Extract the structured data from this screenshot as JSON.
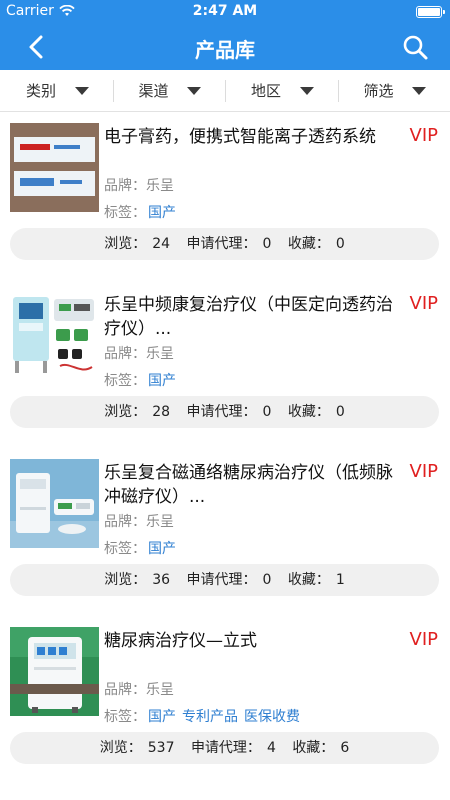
{
  "status_bar": {
    "carrier": "Carrier",
    "time": "2:47 AM",
    "battery_level": 1.0
  },
  "nav": {
    "title": "产品库",
    "back_icon": "chevron-left-icon",
    "search_icon": "search-icon"
  },
  "filters": [
    {
      "label": "类别"
    },
    {
      "label": "渠道"
    },
    {
      "label": "地区"
    },
    {
      "label": "筛选"
    }
  ],
  "products": [
    {
      "title": "电子膏药，便携式智能离子透药系统",
      "vip": "VIP",
      "brand_label": "品牌：",
      "brand": "乐呈",
      "tags_label": "标签：",
      "tags": [
        "国产"
      ],
      "views_label": "浏览：",
      "views": "24",
      "agents_label": "申请代理：",
      "agents": "0",
      "favorites_label": "收藏：",
      "favorites": "0"
    },
    {
      "title": "乐呈中频康复治疗仪（中医定向透药治疗仪）...",
      "vip": "VIP",
      "brand_label": "品牌：",
      "brand": "乐呈",
      "tags_label": "标签：",
      "tags": [
        "国产"
      ],
      "views_label": "浏览：",
      "views": "28",
      "agents_label": "申请代理：",
      "agents": "0",
      "favorites_label": "收藏：",
      "favorites": "0"
    },
    {
      "title": "乐呈复合磁通络糖尿病治疗仪（低频脉冲磁疗仪）...",
      "vip": "VIP",
      "brand_label": "品牌：",
      "brand": "乐呈",
      "tags_label": "标签：",
      "tags": [
        "国产"
      ],
      "views_label": "浏览：",
      "views": "36",
      "agents_label": "申请代理：",
      "agents": "0",
      "favorites_label": "收藏：",
      "favorites": "1"
    },
    {
      "title": "糖尿病治疗仪—立式",
      "vip": "VIP",
      "brand_label": "品牌：",
      "brand": "乐呈",
      "tags_label": "标签：",
      "tags": [
        "国产",
        "专利产品",
        "医保收费"
      ],
      "views_label": "浏览：",
      "views": "537",
      "agents_label": "申请代理：",
      "agents": "4",
      "favorites_label": "收藏：",
      "favorites": "6"
    }
  ],
  "colors": {
    "primary": "#2b8ee8",
    "vip": "#e02020",
    "tag": "#2f7fd1"
  }
}
